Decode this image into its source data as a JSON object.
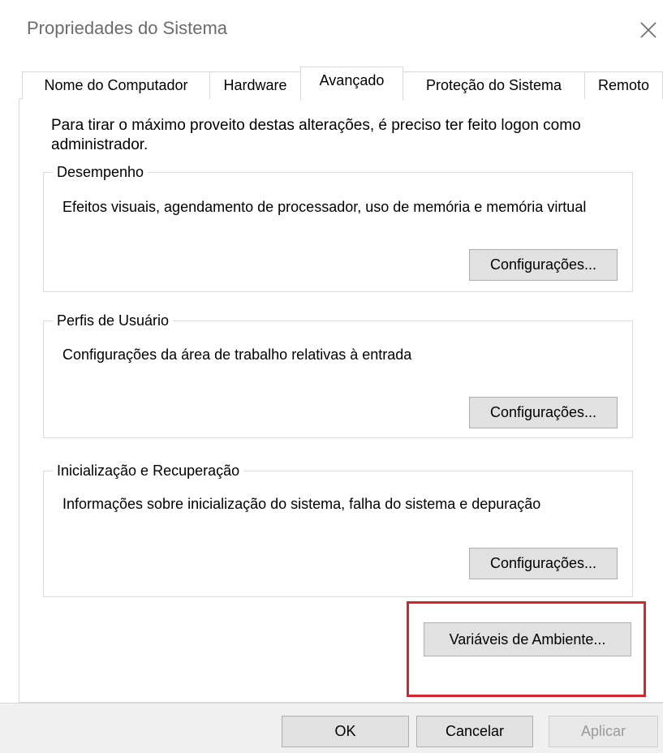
{
  "window": {
    "title": "Propriedades do Sistema"
  },
  "tabs": [
    {
      "label": "Nome do Computador"
    },
    {
      "label": "Hardware"
    },
    {
      "label": "Avançado"
    },
    {
      "label": "Proteção do Sistema"
    },
    {
      "label": "Remoto"
    }
  ],
  "intro": "Para tirar o máximo proveito destas alterações, é preciso ter feito logon como administrador.",
  "groups": [
    {
      "legend": "Desempenho",
      "description": "Efeitos visuais, agendamento de processador, uso de memória e memória virtual",
      "button": "Configurações..."
    },
    {
      "legend": "Perfis de Usuário",
      "description": "Configurações da área de trabalho relativas à entrada",
      "button": "Configurações..."
    },
    {
      "legend": "Inicialização e Recuperação",
      "description": "Informações sobre inicialização do sistema, falha do sistema e depuração",
      "button": "Configurações..."
    }
  ],
  "env_button": "Variáveis de Ambiente...",
  "footer": {
    "ok": "OK",
    "cancel": "Cancelar",
    "apply": "Aplicar"
  },
  "colors": {
    "highlight": "#d6262b",
    "button_bg": "#e1e1e1",
    "border": "#d9d9d9"
  }
}
